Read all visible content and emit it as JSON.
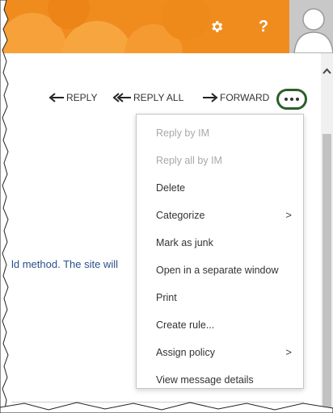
{
  "header": {
    "gear_icon": "gear-icon",
    "help_label": "?",
    "avatar_icon": "person-icon",
    "accent": "#f08c1e"
  },
  "actions": {
    "reply": "REPLY",
    "reply_all": "REPLY ALL",
    "forward": "FORWARD",
    "more_icon": "ellipsis-icon"
  },
  "message": {
    "body_fragment": "ld method. The site will"
  },
  "menu": {
    "items": [
      {
        "label": "Reply by IM",
        "disabled": true
      },
      {
        "label": "Reply all by IM",
        "disabled": true
      },
      {
        "label": "Delete",
        "disabled": false
      },
      {
        "label": "Categorize",
        "submenu": true
      },
      {
        "label": "Mark as junk",
        "disabled": false
      },
      {
        "label": "Open in a separate window",
        "disabled": false
      },
      {
        "label": "Print",
        "disabled": false
      },
      {
        "label": "Create rule...",
        "disabled": false
      },
      {
        "label": "Assign policy",
        "submenu": true
      },
      {
        "label": "View message details",
        "disabled": false
      }
    ],
    "submenu_glyph": ">"
  }
}
